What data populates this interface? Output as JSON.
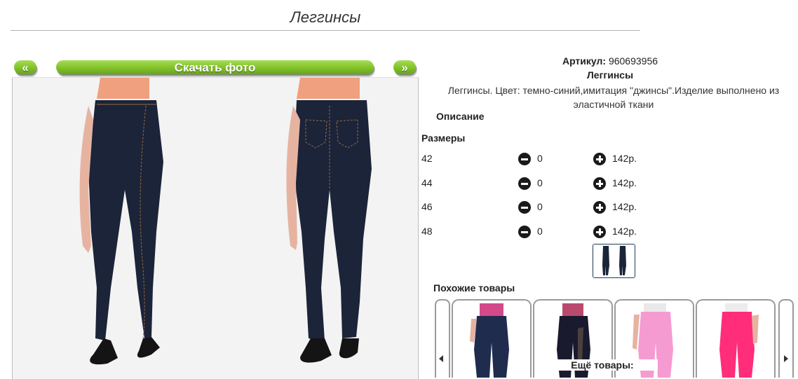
{
  "page": {
    "title": "Леггинсы"
  },
  "gallery": {
    "prev_label": "«",
    "download_label": "Скачать фото",
    "next_label": "»"
  },
  "product": {
    "article_label": "Артикул:",
    "article_value": "960693956",
    "name": "Леггинсы",
    "description": "Леггинсы. Цвет: темно-синий,имитация \"джинсы\".Изделие выполнено из эластичной ткани",
    "description_heading": "Описание",
    "sizes_heading": "Размеры"
  },
  "sizes": [
    {
      "size": "42",
      "qty": "0",
      "price": "142р."
    },
    {
      "size": "44",
      "qty": "0",
      "price": "142р."
    },
    {
      "size": "46",
      "qty": "0",
      "price": "142р."
    },
    {
      "size": "48",
      "qty": "0",
      "price": "142р."
    }
  ],
  "similar": {
    "heading": "Похожие товары",
    "more_label": "Ещё товары:"
  },
  "colors": {
    "accent_green": "#87c72e",
    "legging_navy": "#1b2438",
    "pink": "#f59bd2",
    "hot_pink": "#ff2d7a"
  }
}
